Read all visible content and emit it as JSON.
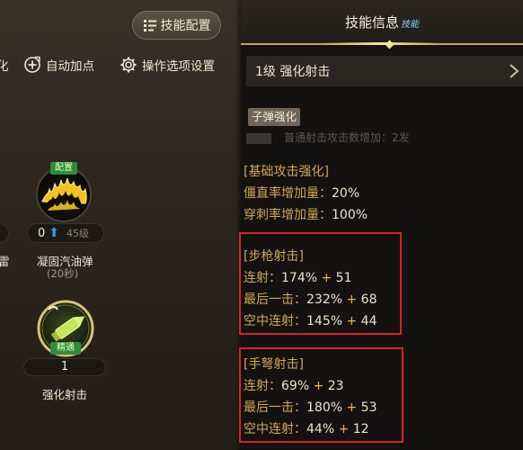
{
  "left": {
    "config_button": "技能配置",
    "cut_char": "化",
    "auto_add": "自动加点",
    "settings": "操作选项设置",
    "skill_fire": {
      "badge": "配置",
      "level": "0",
      "max_level": "45级",
      "name": "凝固汽油弹",
      "cooldown": "(20秒)"
    },
    "cut_name": "雷",
    "skill_bullet": {
      "badge": "精通",
      "level": "1",
      "name": "强化射击"
    }
  },
  "right": {
    "header": {
      "title": "技能信息",
      "tag": "技能"
    },
    "skill_row": "1级 强化射击",
    "sub_tag": "子弹强化",
    "hidden_line": "普通射击攻击数增加：2发",
    "basic": {
      "header": "[基础攻击强化]",
      "stagger_label": "僵直率增加量：",
      "stagger_val": "20%",
      "pierce_label": "穿刺率增加量：",
      "pierce_val": "100%"
    },
    "rifle": {
      "header": "[步枪射击]",
      "rows": [
        {
          "label": "连射：",
          "pct": "174%",
          "plus": "+",
          "flat": "51"
        },
        {
          "label": "最后一击：",
          "pct": "232%",
          "plus": "+",
          "flat": "68"
        },
        {
          "label": "空中连射：",
          "pct": "145%",
          "plus": "+",
          "flat": "44"
        }
      ]
    },
    "crossbow": {
      "header": "[手弩射击]",
      "rows": [
        {
          "label": "连射：",
          "pct": "69%",
          "plus": "+",
          "flat": "23"
        },
        {
          "label": "最后一击：",
          "pct": "180%",
          "plus": "+",
          "flat": "53"
        },
        {
          "label": "空中连射：",
          "pct": "44%",
          "plus": "+",
          "flat": "12"
        }
      ]
    }
  },
  "colors": {
    "accent_gold": "#d4a756",
    "plus_orange": "#f0b34a",
    "highlight_red": "#d62424",
    "badge_green": "#2e8c3a"
  }
}
